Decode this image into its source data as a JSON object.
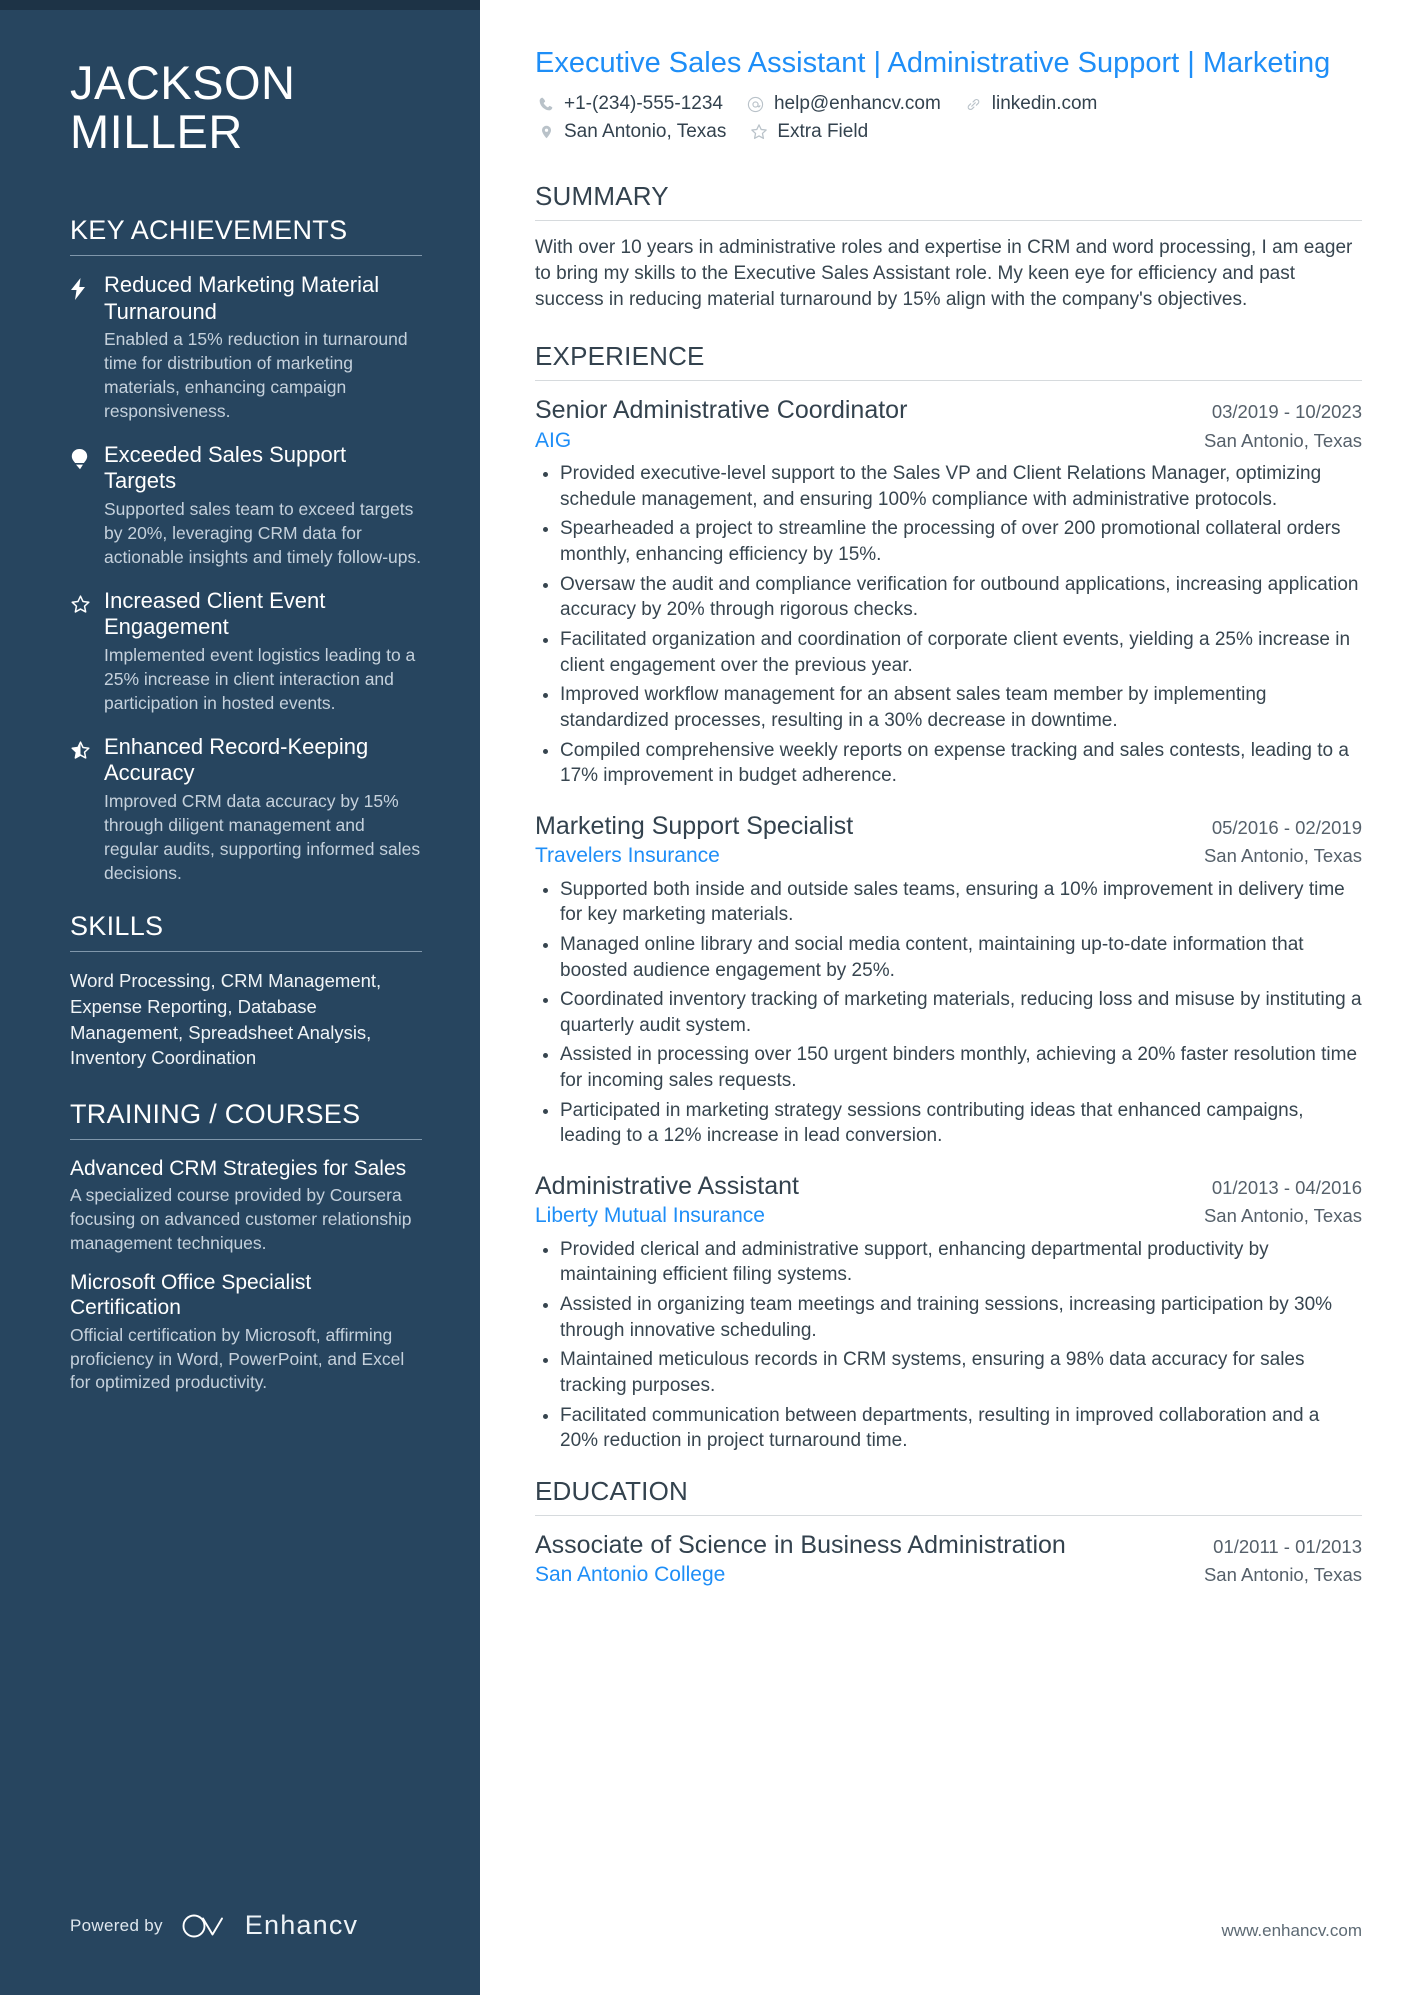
{
  "sidebar": {
    "name_line1": "JACKSON",
    "name_line2": "MILLER",
    "achievements_heading": "KEY ACHIEVEMENTS",
    "achievements": [
      {
        "icon": "lightning-bolt-icon",
        "title": "Reduced Marketing Material Turnaround",
        "description": "Enabled a 15% reduction in turnaround time for distribution of marketing materials, enhancing campaign responsiveness."
      },
      {
        "icon": "lightbulb-icon",
        "title": "Exceeded Sales Support Targets",
        "description": "Supported sales team to exceed targets by 20%, leveraging CRM data for actionable insights and timely follow-ups."
      },
      {
        "icon": "star-outline-icon",
        "title": "Increased Client Event Engagement",
        "description": "Implemented event logistics leading to a 25% increase in client interaction and participation in hosted events."
      },
      {
        "icon": "star-half-filled-icon",
        "title": "Enhanced Record-Keeping Accuracy",
        "description": "Improved CRM data accuracy by 15% through diligent management and regular audits, supporting informed sales decisions."
      }
    ],
    "skills_heading": "SKILLS",
    "skills_text": "Word Processing, CRM Management, Expense Reporting, Database Management, Spreadsheet Analysis, Inventory Coordination",
    "training_heading": "TRAINING / COURSES",
    "courses": [
      {
        "title": "Advanced CRM Strategies for Sales",
        "description": "A specialized course provided by Coursera focusing on advanced customer relationship management techniques."
      },
      {
        "title": "Microsoft Office Specialist Certification",
        "description": "Official certification by Microsoft, affirming proficiency in Word, PowerPoint, and Excel for optimized productivity."
      }
    ],
    "powered_by_label": "Powered by",
    "brand_name": "Enhancv"
  },
  "header": {
    "job_title": "Executive Sales Assistant | Administrative Support | Marketing",
    "contacts_row1": [
      {
        "icon": "phone-icon",
        "value": "+1-(234)-555-1234"
      },
      {
        "icon": "email-at-icon",
        "value": "help@enhancv.com"
      },
      {
        "icon": "link-icon",
        "value": "linkedin.com"
      }
    ],
    "contacts_row2": [
      {
        "icon": "location-pin-icon",
        "value": "San Antonio, Texas"
      },
      {
        "icon": "star-outline-icon",
        "value": "Extra Field"
      }
    ]
  },
  "summary": {
    "heading": "SUMMARY",
    "text": "With over 10 years in administrative roles and expertise in CRM and word processing, I am eager to bring my skills to the Executive Sales Assistant role. My keen eye for efficiency and past success in reducing material turnaround by 15% align with the company's objectives."
  },
  "experience": {
    "heading": "EXPERIENCE",
    "entries": [
      {
        "title": "Senior Administrative Coordinator",
        "date": "03/2019 - 10/2023",
        "organization": "AIG",
        "location": "San Antonio, Texas",
        "bullets": [
          "Provided executive-level support to the Sales VP and Client Relations Manager, optimizing schedule management, and ensuring 100% compliance with administrative protocols.",
          "Spearheaded a project to streamline the processing of over 200 promotional collateral orders monthly, enhancing efficiency by 15%.",
          "Oversaw the audit and compliance verification for outbound applications, increasing application accuracy by 20% through rigorous checks.",
          "Facilitated organization and coordination of corporate client events, yielding a 25% increase in client engagement over the previous year.",
          "Improved workflow management for an absent sales team member by implementing standardized processes, resulting in a 30% decrease in downtime.",
          "Compiled comprehensive weekly reports on expense tracking and sales contests, leading to a 17% improvement in budget adherence."
        ]
      },
      {
        "title": "Marketing Support Specialist",
        "date": "05/2016 - 02/2019",
        "organization": "Travelers Insurance",
        "location": "San Antonio, Texas",
        "bullets": [
          "Supported both inside and outside sales teams, ensuring a 10% improvement in delivery time for key marketing materials.",
          "Managed online library and social media content, maintaining up-to-date information that boosted audience engagement by 25%.",
          "Coordinated inventory tracking of marketing materials, reducing loss and misuse by instituting a quarterly audit system.",
          "Assisted in processing over 150 urgent binders monthly, achieving a 20% faster resolution time for incoming sales requests.",
          "Participated in marketing strategy sessions contributing ideas that enhanced campaigns, leading to a 12% increase in lead conversion."
        ]
      },
      {
        "title": "Administrative Assistant",
        "date": "01/2013 - 04/2016",
        "organization": "Liberty Mutual Insurance",
        "location": "San Antonio, Texas",
        "bullets": [
          "Provided clerical and administrative support, enhancing departmental productivity by maintaining efficient filing systems.",
          "Assisted in organizing team meetings and training sessions, increasing participation by 30% through innovative scheduling.",
          "Maintained meticulous records in CRM systems, ensuring a 98% data accuracy for sales tracking purposes.",
          "Facilitated communication between departments, resulting in improved collaboration and a 20% reduction in project turnaround time."
        ]
      }
    ]
  },
  "education": {
    "heading": "EDUCATION",
    "entries": [
      {
        "title": "Associate of Science in Business Administration",
        "date": "01/2011 - 01/2013",
        "organization": "San Antonio College",
        "location": "San Antonio, Texas"
      }
    ]
  },
  "footer": {
    "website": "www.enhancv.com"
  },
  "colors": {
    "sidebar_bg": "#27455f",
    "accent_blue": "#1e8ef7",
    "text_dark": "#33424e"
  }
}
